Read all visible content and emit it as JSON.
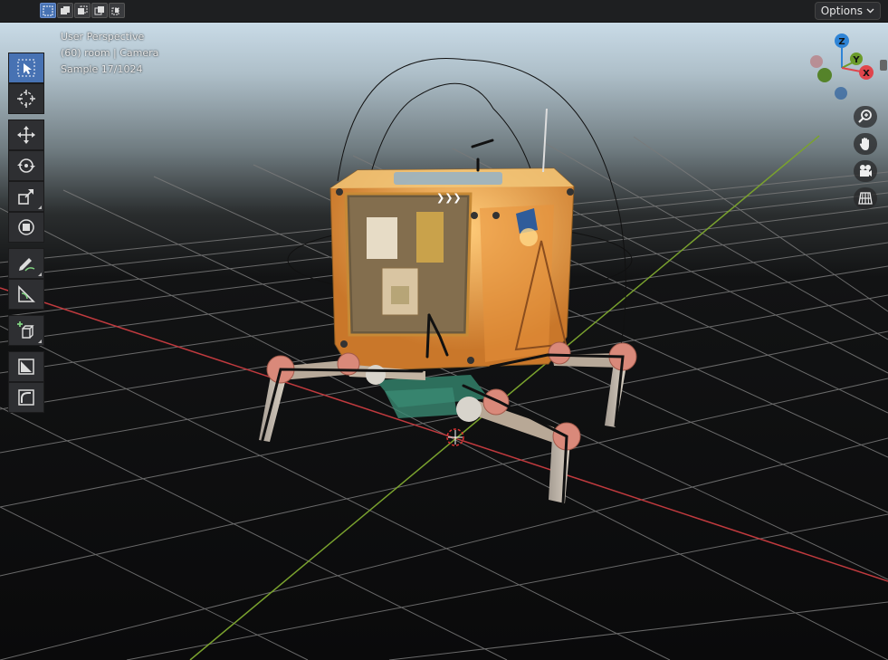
{
  "header": {
    "select_modes": [
      {
        "name": "select-box-icon",
        "active": true
      },
      {
        "name": "select-extend-icon",
        "active": false
      },
      {
        "name": "select-subtract-icon",
        "active": false
      },
      {
        "name": "select-invert-icon",
        "active": false
      },
      {
        "name": "select-intersect-icon",
        "active": false
      }
    ],
    "options_label": "Options"
  },
  "viewport": {
    "view_name": "User Perspective",
    "collection_info": "(60) room | Camera",
    "render_sample": "Sample 17/1024"
  },
  "gizmo": {
    "z_label": "Z",
    "y_label": "Y",
    "x_label": "X",
    "colors": {
      "x": "#e0454c",
      "y": "#6b9b2a",
      "z": "#2f84d6"
    }
  },
  "toolbar": {
    "tools": [
      {
        "name": "select-box-tool",
        "icon": "cursor-box-icon",
        "active": true
      },
      {
        "name": "cursor-tool",
        "icon": "crosshair-icon",
        "active": false
      },
      {
        "name": "move-tool",
        "icon": "move-arrows-icon",
        "active": false
      },
      {
        "name": "rotate-tool",
        "icon": "rotate-icon",
        "active": false
      },
      {
        "name": "scale-tool",
        "icon": "scale-icon",
        "active": false
      },
      {
        "name": "transform-tool",
        "icon": "transform-icon",
        "active": false
      },
      {
        "name": "annotate-tool",
        "icon": "pencil-icon",
        "active": false
      },
      {
        "name": "measure-tool",
        "icon": "ruler-icon",
        "active": false
      },
      {
        "name": "add-cube-tool",
        "icon": "add-cube-icon",
        "active": false
      },
      {
        "name": "shade-tool",
        "icon": "shade-icon",
        "active": false
      },
      {
        "name": "smooth-tool",
        "icon": "smooth-icon",
        "active": false
      }
    ]
  },
  "nav": [
    "zoom-icon",
    "hand-pan-icon",
    "camera-icon",
    "grid-ortho-icon"
  ],
  "colors": {
    "accent": "#4772b3",
    "toolbar_bg": "#2e2f32",
    "header_bg": "#1e1f21"
  }
}
